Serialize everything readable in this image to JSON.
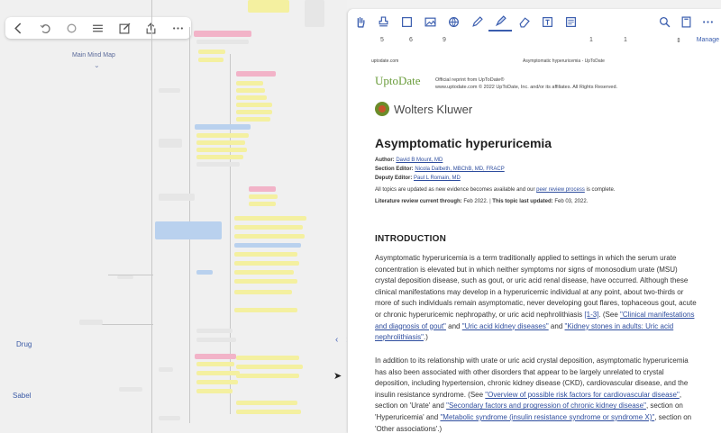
{
  "left_toolbar": {
    "icons": [
      "back-icon",
      "undo-icon",
      "redo-icon",
      "list-icon",
      "edit-icon",
      "share-icon",
      "more-icon"
    ]
  },
  "mindmap": {
    "root": "Main Mind Map",
    "side_labels": [
      "Drug",
      "Sabel"
    ]
  },
  "annotation_toolbar": {
    "tools": [
      "hand-icon",
      "stamp-icon",
      "frame-icon",
      "image-icon",
      "globe-icon",
      "pen-icon",
      "highlighter-icon",
      "eraser-icon",
      "text-box-icon",
      "crop-icon"
    ],
    "right_tools": [
      "search-icon",
      "page-icon",
      "more-icon"
    ]
  },
  "ruler": {
    "numbers": [
      "5",
      "6",
      "9",
      "1",
      "1"
    ],
    "manage_label": "Manage"
  },
  "document": {
    "header_left": "uptodate.com",
    "header_center": "Asymptomatic hyperuricemia - UpToDate",
    "logo": "UptoDate",
    "logo_lines": [
      "Official reprint from UpToDate®",
      "www.uptodate.com © 2022 UpToDate, Inc. and/or its affiliates. All Rights Reserved."
    ],
    "publisher": "Wolters Kluwer",
    "title": "Asymptomatic hyperuricemia",
    "author_label": "Author:",
    "author": "David B Mount, MD",
    "section_editor_label": "Section Editor:",
    "section_editor": "Nicola Dalbeth, MBChB, MD, FRACP",
    "deputy_editor_label": "Deputy Editor:",
    "deputy_editor": "Paul L Romain, MD",
    "update_note_pre": "All topics are updated as new evidence becomes available and our",
    "update_note_link": "peer review process",
    "update_note_post": "is complete.",
    "lit_review_label": "Literature review current through:",
    "lit_review_date": "Feb 2022.",
    "last_updated_label": "This topic last updated:",
    "last_updated_date": "Feb 03, 2022.",
    "section_heading": "INTRODUCTION",
    "para1_text": "Asymptomatic hyperuricemia is a term traditionally applied to settings in which the serum urate concentration is elevated but in which neither symptoms nor signs of monosodium urate (MSU) crystal deposition disease, such as gout, or uric acid renal disease, have occurred. Although these clinical manifestations may develop in a hyperuricemic individual at any point, about two-thirds or more of such individuals remain asymptomatic, never developing gout flares, tophaceous gout, acute or chronic hyperuricemic nephropathy, or uric acid nephrolithiasis",
    "para1_ref": "[1-3]",
    "para1_see": ". (See",
    "para1_link1": "\"Clinical manifestations and diagnosis of gout\"",
    "para1_and": "and",
    "para1_link2": "\"Uric acid kidney diseases\"",
    "para1_and2": "and",
    "para1_link3": "\"Kidney stones in adults: Uric acid nephrolithiasis\"",
    "para1_end": ".)",
    "para2_text": "In addition to its relationship with urate or uric acid crystal deposition, asymptomatic hyperuricemia has also been associated with other disorders that appear to be largely unrelated to crystal deposition, including hypertension, chronic kidney disease (CKD), cardiovascular disease, and the insulin resistance syndrome. (See",
    "para2_link1": "\"Overview of possible risk factors for cardiovascular disease\"",
    "para2_mid1": ", section on 'Urate' and",
    "para2_link2": "\"Secondary factors and progression of chronic kidney disease\"",
    "para2_mid2": ", section on 'Hyperuricemia' and",
    "para2_link3": "\"Metabolic syndrome (insulin resistance syndrome or syndrome X)\"",
    "para2_end": ", section on 'Other associations'.)"
  },
  "colors": {
    "accent": "#3a5dae",
    "uptodate_green": "#6a9c3b",
    "highlight_yellow": "#f4f0a0",
    "highlight_pink": "#f2b3c8",
    "highlight_blue": "#b9d1ee"
  }
}
